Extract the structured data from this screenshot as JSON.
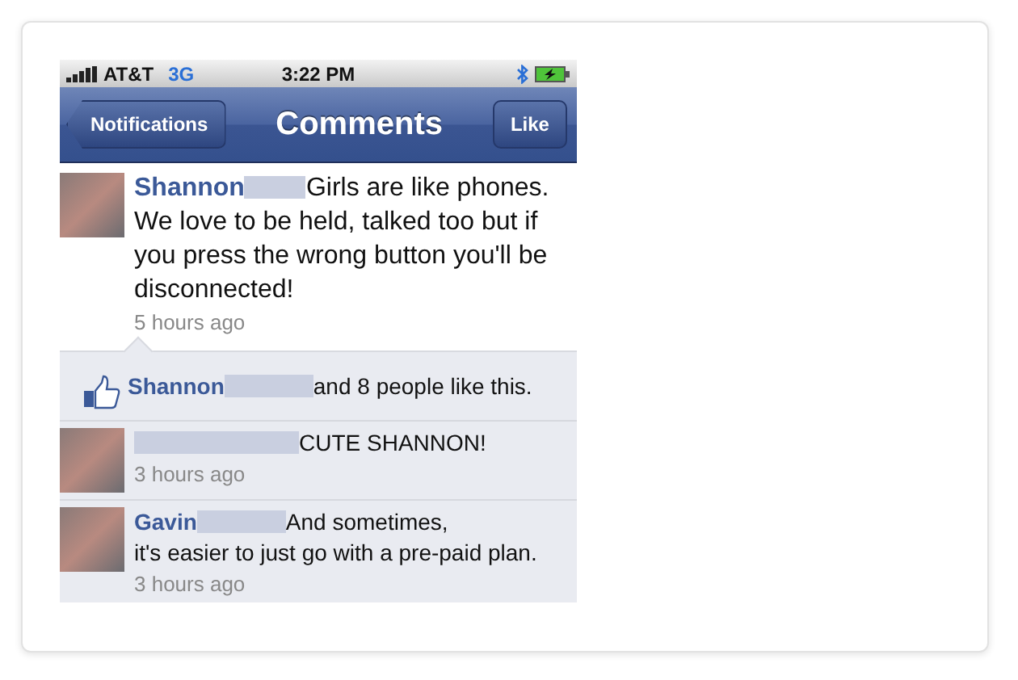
{
  "status_bar": {
    "carrier": "AT&T",
    "network": "3G",
    "time": "3:22 PM",
    "bluetooth": true,
    "battery_charging": true
  },
  "nav_bar": {
    "back_button": "Notifications",
    "title": "Comments",
    "action_button": "Like"
  },
  "post": {
    "author": "Shannon",
    "name_redacted": true,
    "text": "Girls are like phones. We love to be held, talked too but if you press the wrong button you'll be disconnected!",
    "time": "5 hours ago"
  },
  "likes": {
    "author": "Shannon",
    "name_redacted": true,
    "text": "and 8 people like this."
  },
  "comments": [
    {
      "name_redacted": true,
      "text": "CUTE SHANNON!",
      "time": "3 hours ago"
    },
    {
      "author": "Gavin",
      "name_redacted": true,
      "text": "And sometimes,\nit's easier to just go with a pre-paid plan.",
      "time": "3 hours ago"
    }
  ]
}
